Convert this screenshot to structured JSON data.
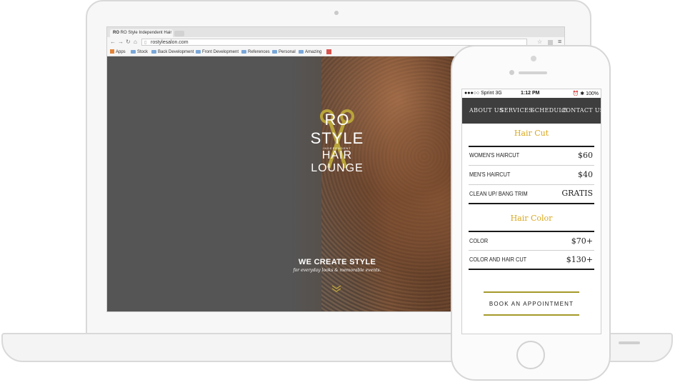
{
  "browser": {
    "tab_title": "RO Style Independent Hair",
    "tab_logo": "RO",
    "url": "rostylesalon.com",
    "bookmarks": [
      {
        "label": "Apps",
        "icon": "apps-icon"
      },
      {
        "label": "Stock",
        "icon": "folder-icon"
      },
      {
        "label": "Back Development",
        "icon": "folder-icon"
      },
      {
        "label": "Front Development",
        "icon": "folder-icon"
      },
      {
        "label": "References",
        "icon": "folder-icon"
      },
      {
        "label": "Personal",
        "icon": "folder-icon"
      },
      {
        "label": "Amazing",
        "icon": "folder-icon"
      }
    ]
  },
  "hero": {
    "logo_line1": "RO STYLE",
    "logo_line2": "INDEPENDENT",
    "logo_line3": "HAIR LOUNGE",
    "headline": "WE CREATE STYLE",
    "subline": "for everyday looks & memorable events."
  },
  "phone": {
    "status": {
      "carrier": "●●●○○ Sprint  3G",
      "time": "1:12 PM",
      "battery": "⏰ ✱ 100%"
    },
    "nav": [
      "ABOUT US",
      "SERVICES",
      "SCHEDULE",
      "CONTACT US"
    ],
    "sections": [
      {
        "title": "Hair Cut",
        "items": [
          {
            "label": "WOMEN'S HAIRCUT",
            "price": "$60"
          },
          {
            "label": "MEN'S HAIRCUT",
            "price": "$40"
          },
          {
            "label": "CLEAN UP/ BANG TRIM",
            "price": "GRATIS"
          }
        ]
      },
      {
        "title": "Hair Color",
        "items": [
          {
            "label": "COLOR",
            "price": "$70+"
          },
          {
            "label": "COLOR AND HAIR CUT",
            "price": "$130+"
          }
        ]
      }
    ],
    "cta": "BOOK AN APPOINTMENT"
  },
  "colors": {
    "accent_gold": "#d9a71c",
    "nav_bg": "#3e3e3e",
    "cta_line": "#a59a2a"
  }
}
